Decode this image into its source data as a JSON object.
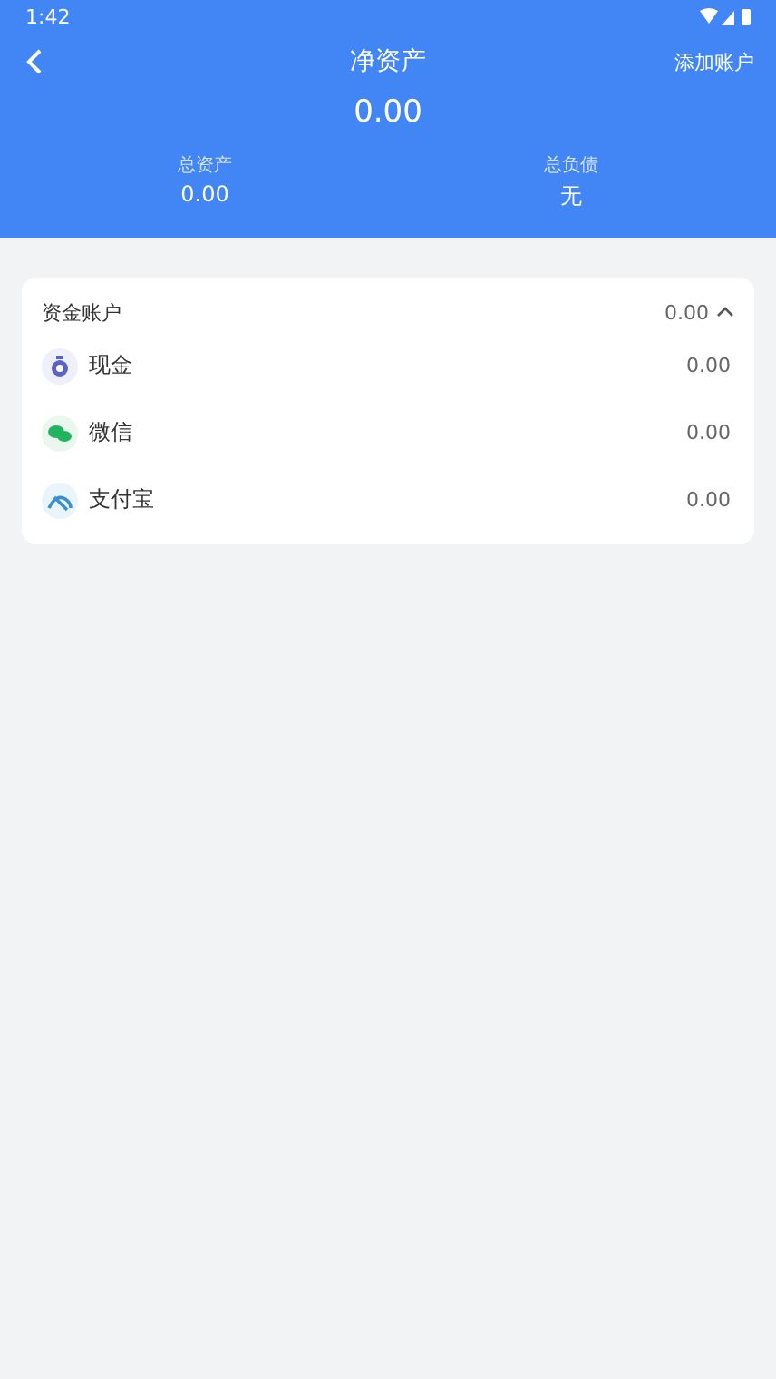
{
  "status_bar": {
    "time": "1:42"
  },
  "header": {
    "title": "净资产",
    "action": "添加账户",
    "net_value": "0.00",
    "stats": [
      {
        "label": "总资产",
        "value": "0.00"
      },
      {
        "label": "总负债",
        "value": "无"
      }
    ]
  },
  "group": {
    "title": "资金账户",
    "total": "0.00",
    "expanded": true,
    "accounts": [
      {
        "kind": "cash",
        "name": "现金",
        "amount": "0.00"
      },
      {
        "kind": "wechat",
        "name": "微信",
        "amount": "0.00"
      },
      {
        "kind": "alipay",
        "name": "支付宝",
        "amount": "0.00"
      }
    ]
  }
}
